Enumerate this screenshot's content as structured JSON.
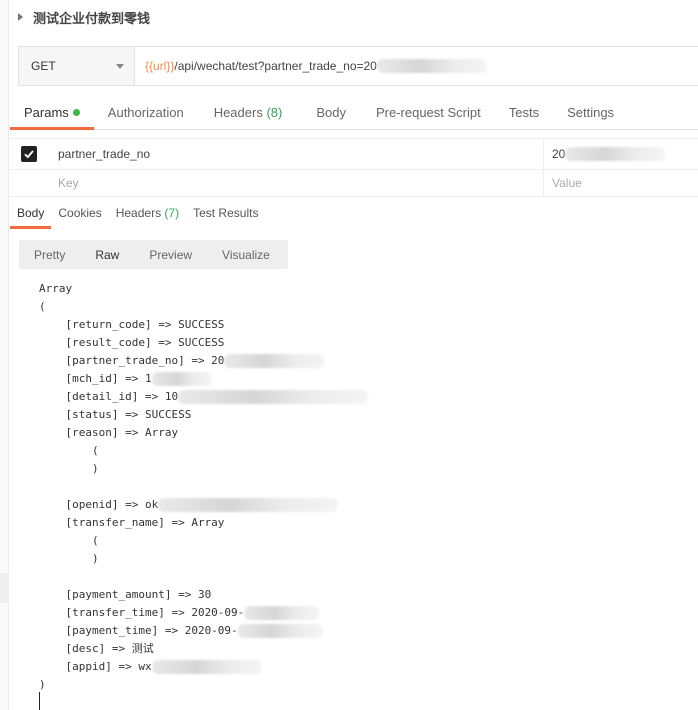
{
  "request": {
    "title": "测试企业付款到零钱",
    "method": "GET",
    "url_var": "{{url}}",
    "url_path": "/api/wechat/test?partner_trade_no=20"
  },
  "request_tabs": [
    {
      "label": "Params",
      "count": ""
    },
    {
      "label": "Authorization",
      "count": ""
    },
    {
      "label": "Headers ",
      "count": "(8)"
    },
    {
      "label": "Body",
      "count": ""
    },
    {
      "label": "Pre-request Script",
      "count": ""
    },
    {
      "label": "Tests",
      "count": ""
    },
    {
      "label": "Settings",
      "count": ""
    }
  ],
  "params": {
    "rows": [
      {
        "key": "partner_trade_no",
        "value": "20"
      }
    ],
    "key_placeholder": "Key",
    "value_placeholder": "Value"
  },
  "response_tabs": [
    {
      "label": "Body",
      "count": ""
    },
    {
      "label": "Cookies",
      "count": ""
    },
    {
      "label": "Headers ",
      "count": "(7)"
    },
    {
      "label": "Test Results",
      "count": ""
    }
  ],
  "view_modes": [
    "Pretty",
    "Raw",
    "Preview",
    "Visualize"
  ],
  "response_body": [
    "Array",
    "(",
    "    [return_code] => SUCCESS",
    "    [result_code] => SUCCESS",
    "    [partner_trade_no] => 20",
    "    [mch_id] => 1",
    "    [detail_id] => 10",
    "    [status] => SUCCESS",
    "    [reason] => Array",
    "        (",
    "        )",
    "",
    "    [openid] => ok",
    "    [transfer_name] => Array",
    "        (",
    "        )",
    "",
    "    [payment_amount] => 30",
    "    [transfer_time] => 2020-09-",
    "    [payment_time] => 2020-09-",
    "    [desc] => 测试",
    "    [appid] => wx",
    ")"
  ],
  "colors": {
    "accent": "#f26b3a",
    "count_green": "#3aa35b",
    "var_orange": "#f08d49",
    "status_dot": "#39b54a"
  }
}
